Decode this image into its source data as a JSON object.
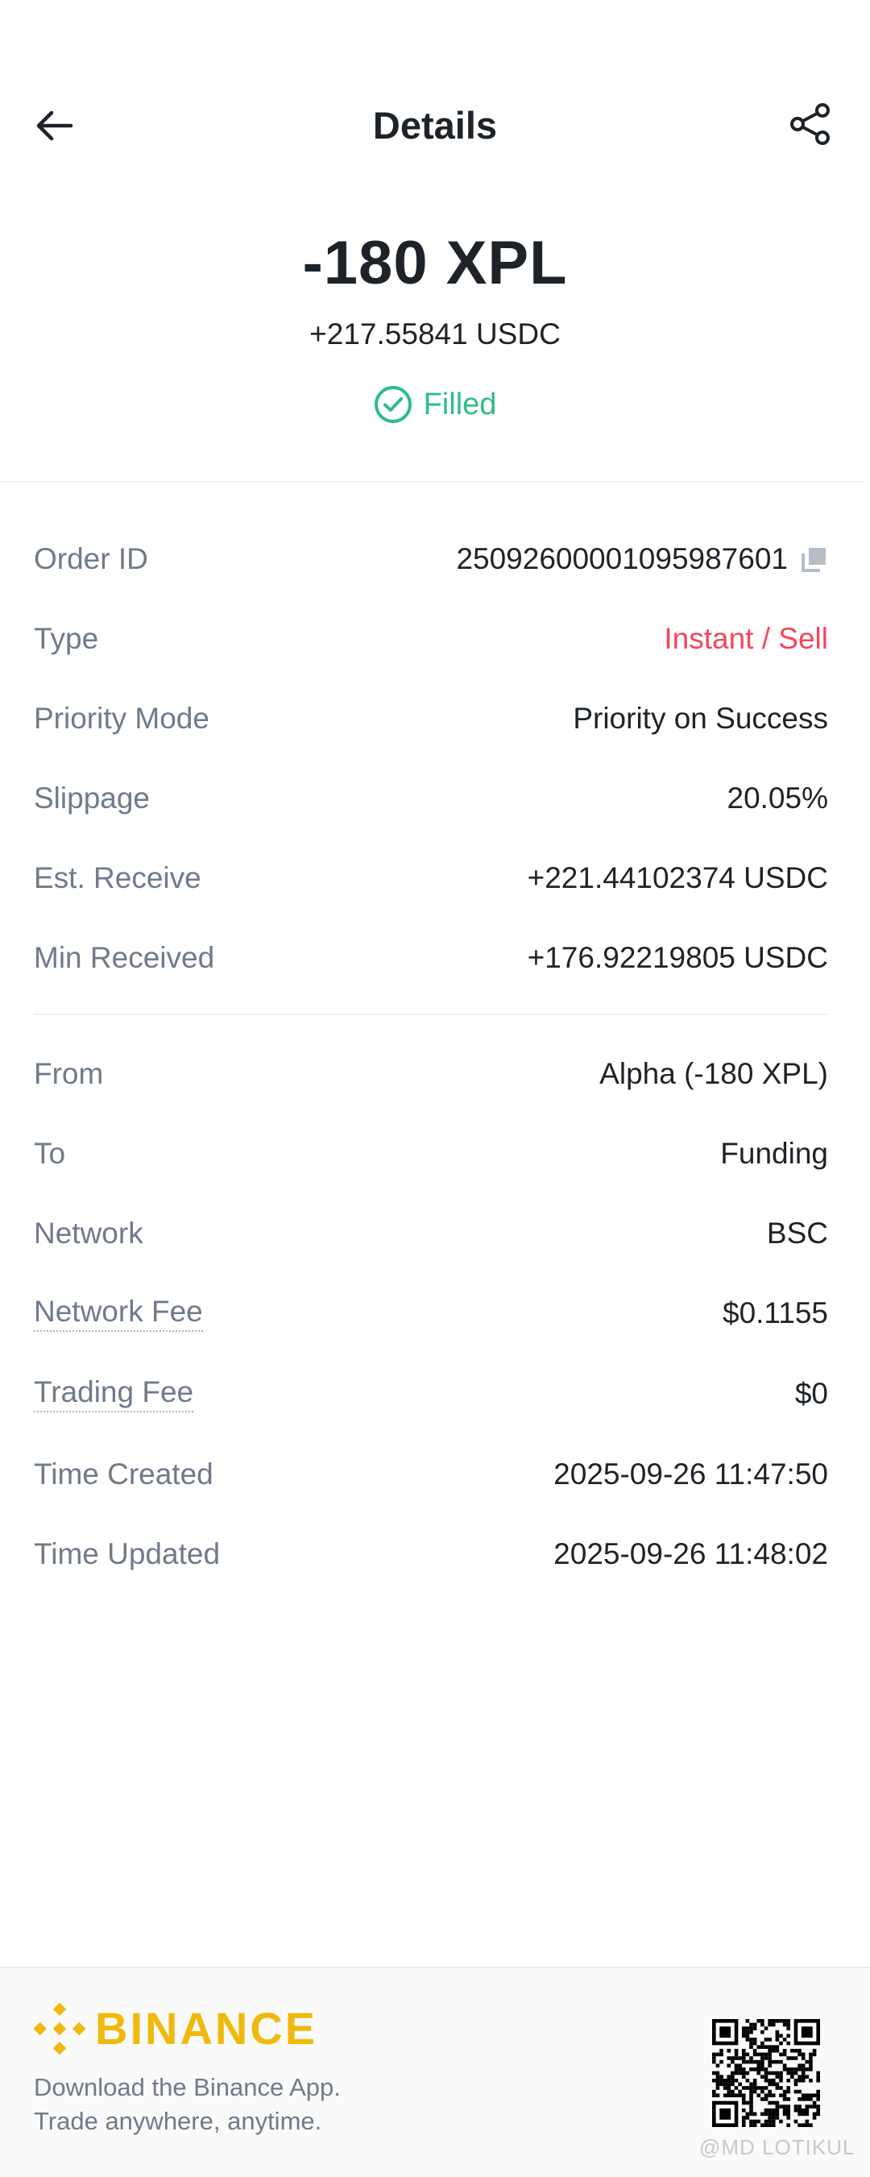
{
  "header": {
    "title": "Details"
  },
  "summary": {
    "amount": "-180 XPL",
    "sub_amount": "+217.55841 USDC",
    "status": "Filled",
    "status_color": "#2ebd85"
  },
  "rows": [
    {
      "label": "Order ID",
      "value": "250926000010959876​01"
    },
    {
      "label": "Type",
      "value": "Instant / Sell"
    },
    {
      "label": "Priority Mode",
      "value": "Priority on Success"
    },
    {
      "label": "Slippage",
      "value": "20.05%"
    },
    {
      "label": "Est. Receive",
      "value": "+221.44102374 USDC"
    },
    {
      "label": "Min Received",
      "value": "+176.92219805 USDC"
    },
    {
      "label": "From",
      "value": "Alpha (-180 XPL)"
    },
    {
      "label": "To",
      "value": "Funding"
    },
    {
      "label": "Network",
      "value": "BSC"
    },
    {
      "label": "Network Fee",
      "value": "$0.1155"
    },
    {
      "label": "Trading Fee",
      "value": "$0"
    },
    {
      "label": "Time Created",
      "value": "2025-09-26 11:47:50"
    },
    {
      "label": "Time Updated",
      "value": "2025-09-26 11:48:02"
    }
  ],
  "colors": {
    "sell": "#f6465d",
    "brand": "#f0b90b",
    "label": "#707a8a"
  },
  "footer": {
    "brand": "BINANCE",
    "tagline_line1": "Download the Binance App.",
    "tagline_line2": "Trade anywhere, anytime."
  },
  "watermark": "@MD LOTIKUL",
  "icons": {
    "back": "arrow-left-icon",
    "share": "share-icon",
    "status": "check-circle-icon",
    "copy": "copy-icon",
    "logo": "binance-logo-icon",
    "qr": "qr-code"
  }
}
